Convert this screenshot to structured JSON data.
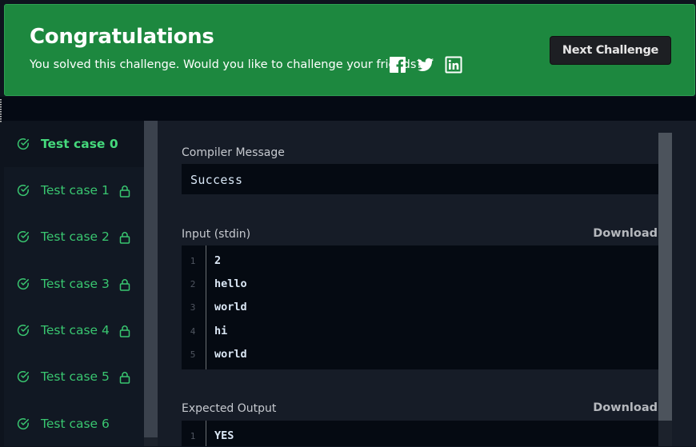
{
  "banner": {
    "title": "Congratulations",
    "text": "You solved this challenge. Would you like to challenge your friends?",
    "social": [
      "facebook-icon",
      "twitter-icon",
      "linkedin-icon"
    ],
    "next_label": "Next Challenge",
    "color": "#1d883f"
  },
  "test_cases": [
    {
      "label": "Test case 0",
      "locked": false,
      "active": true
    },
    {
      "label": "Test case 1",
      "locked": true,
      "active": false
    },
    {
      "label": "Test case 2",
      "locked": true,
      "active": false
    },
    {
      "label": "Test case 3",
      "locked": true,
      "active": false
    },
    {
      "label": "Test case 4",
      "locked": true,
      "active": false
    },
    {
      "label": "Test case 5",
      "locked": true,
      "active": false
    },
    {
      "label": "Test case 6",
      "locked": false,
      "active": false
    }
  ],
  "compiler": {
    "label": "Compiler Message",
    "message": "Success"
  },
  "input": {
    "label": "Input (stdin)",
    "download": "Download",
    "lines": [
      {
        "n": "1",
        "text": "2"
      },
      {
        "n": "2",
        "text": "hello"
      },
      {
        "n": "3",
        "text": "world"
      },
      {
        "n": "4",
        "text": "hi"
      },
      {
        "n": "5",
        "text": "world"
      }
    ]
  },
  "expected": {
    "label": "Expected Output",
    "download": "Download",
    "lines": [
      {
        "n": "1",
        "text": "YES"
      }
    ]
  },
  "colors": {
    "success_green": "#39c670",
    "background": "#0e141e"
  }
}
